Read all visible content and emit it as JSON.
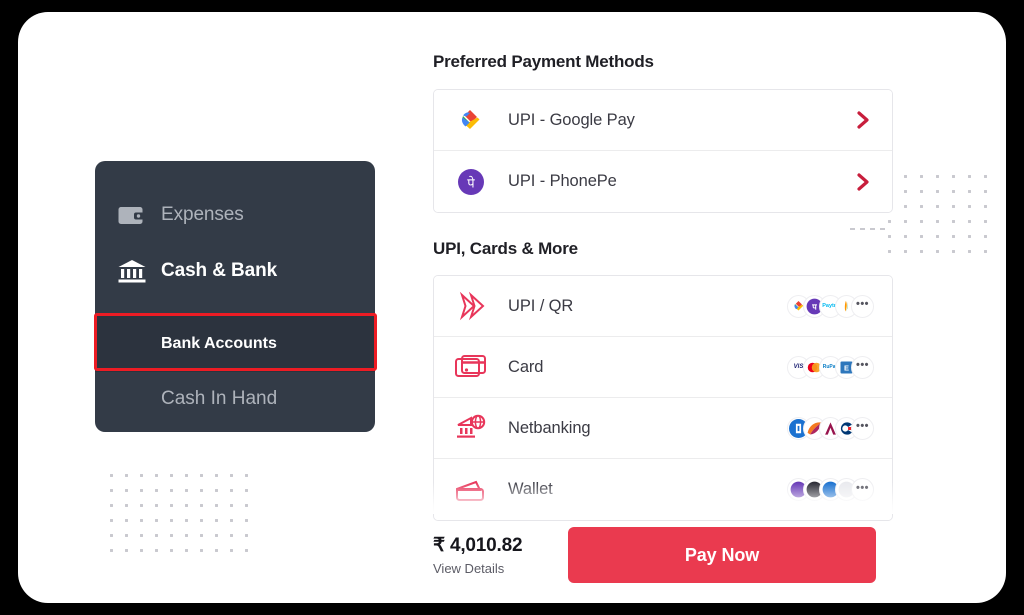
{
  "sidebar": {
    "items": [
      {
        "id": "expenses",
        "label": "Expenses",
        "icon": "wallet-icon"
      },
      {
        "id": "cash-bank",
        "label": "Cash & Bank",
        "icon": "bank-building-icon"
      },
      {
        "id": "bank-accounts",
        "label": "Bank Accounts",
        "icon": "none"
      },
      {
        "id": "cash-in-hand",
        "label": "Cash In Hand",
        "icon": "none"
      }
    ],
    "selected": "bank-accounts",
    "annotation_color": "#ed1c24",
    "background_color": "#333b47",
    "selected_background_color": "#2c333e"
  },
  "payment": {
    "preferred_title": "Preferred Payment Methods",
    "preferred_methods": [
      {
        "label": "UPI - Google Pay",
        "icon": "google-pay-icon",
        "chevron": "chevron-right-icon"
      },
      {
        "label": "UPI - PhonePe",
        "icon": "phonepe-icon",
        "chevron": "chevron-right-icon"
      }
    ],
    "more_title": "UPI, Cards & More",
    "more_methods": [
      {
        "label": "UPI / QR",
        "icon": "bhim-upi-icon",
        "badges": [
          "google-pay",
          "phonepe",
          "paytm",
          "amazon-pay"
        ],
        "more_label": "•••"
      },
      {
        "label": "Card",
        "icon": "credit-card-icon",
        "badges": [
          "visa",
          "mastercard",
          "rupay",
          "amex"
        ],
        "more_label": "•••"
      },
      {
        "label": "Netbanking",
        "icon": "netbanking-globe-icon",
        "badges": [
          "hdfc",
          "icici",
          "axis",
          "kotak"
        ],
        "more_label": "•••"
      },
      {
        "label": "Wallet",
        "icon": "wallet-outline-icon",
        "badges": [
          "phonepe",
          "paytm",
          "mobikwik",
          "freecharge"
        ],
        "more_label": "•••"
      }
    ],
    "chevron_color": "#c81e3c",
    "accent_color": "#ea3a4f"
  },
  "pay_bar": {
    "amount": "₹ 4,010.82",
    "view_details_label": "View Details",
    "pay_button_label": "Pay Now"
  }
}
